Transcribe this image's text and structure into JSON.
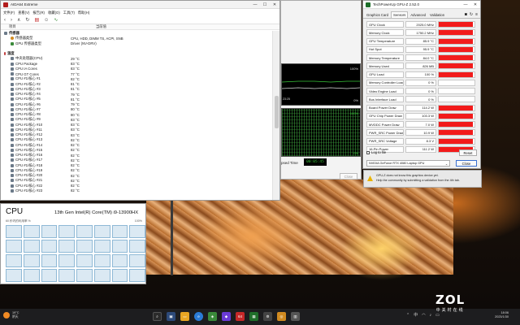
{
  "aida": {
    "title": "AIDA64 Extreme",
    "menu": [
      "文件(F)",
      "查看(V)",
      "报告(R)",
      "收藏(O)",
      "工具(T)",
      "帮助(H)"
    ],
    "col_item": "项目",
    "col_value": "当前值",
    "rows": [
      {
        "label": "传感器",
        "value": "",
        "type": "section",
        "icon": "chip"
      },
      {
        "label": "传感器类型",
        "value": "CPU, HDD, DIMM TS, ACPI, SNB",
        "type": "sub",
        "icon": "circle"
      },
      {
        "label": "GPU 传感器类型",
        "value": "Driver (NV-DRV)",
        "type": "sub",
        "icon": "gpu"
      },
      {
        "label": "",
        "value": "",
        "type": "blank",
        "icon": ""
      },
      {
        "label": "温度",
        "value": "",
        "type": "section",
        "icon": "therm"
      },
      {
        "label": "中央处理器(CPU)",
        "value": "29 °C",
        "type": "sub",
        "icon": "chip"
      },
      {
        "label": "CPU Package",
        "value": "83 °C",
        "type": "sub",
        "icon": "chip"
      },
      {
        "label": "CPU IA Cores",
        "value": "83 °C",
        "type": "sub",
        "icon": "chip"
      },
      {
        "label": "CPU GT Cores",
        "value": "77 °C",
        "type": "sub",
        "icon": "chip"
      },
      {
        "label": "CPU #1/核心 #1",
        "value": "82 °C",
        "type": "sub",
        "icon": "chip"
      },
      {
        "label": "CPU #1/核心 #2",
        "value": "81 °C",
        "type": "sub",
        "icon": "chip"
      },
      {
        "label": "CPU #1/核心 #3",
        "value": "81 °C",
        "type": "sub",
        "icon": "chip"
      },
      {
        "label": "CPU #1/核心 #4",
        "value": "79 °C",
        "type": "sub",
        "icon": "chip"
      },
      {
        "label": "CPU #1/核心 #5",
        "value": "81 °C",
        "type": "sub",
        "icon": "chip"
      },
      {
        "label": "CPU #1/核心 #6",
        "value": "79 °C",
        "type": "sub",
        "icon": "chip"
      },
      {
        "label": "CPU #1/核心 #7",
        "value": "80 °C",
        "type": "sub",
        "icon": "chip"
      },
      {
        "label": "CPU #1/核心 #8",
        "value": "80 °C",
        "type": "sub",
        "icon": "chip"
      },
      {
        "label": "CPU #1/核心 #9",
        "value": "83 °C",
        "type": "sub",
        "icon": "chip"
      },
      {
        "label": "CPU #1/核心 #10",
        "value": "83 °C",
        "type": "sub",
        "icon": "chip"
      },
      {
        "label": "CPU #1/核心 #11",
        "value": "83 °C",
        "type": "sub",
        "icon": "chip"
      },
      {
        "label": "CPU #1/核心 #12",
        "value": "83 °C",
        "type": "sub",
        "icon": "chip"
      },
      {
        "label": "CPU #1/核心 #13",
        "value": "82 °C",
        "type": "sub",
        "icon": "chip"
      },
      {
        "label": "CPU #1/核心 #14",
        "value": "82 °C",
        "type": "sub",
        "icon": "chip"
      },
      {
        "label": "CPU #1/核心 #15",
        "value": "82 °C",
        "type": "sub",
        "icon": "chip"
      },
      {
        "label": "CPU #1/核心 #16",
        "value": "82 °C",
        "type": "sub",
        "icon": "chip"
      },
      {
        "label": "CPU #1/核心 #17",
        "value": "82 °C",
        "type": "sub",
        "icon": "chip"
      },
      {
        "label": "CPU #1/核心 #18",
        "value": "82 °C",
        "type": "sub",
        "icon": "chip"
      },
      {
        "label": "CPU #1/核心 #19",
        "value": "82 °C",
        "type": "sub",
        "icon": "chip"
      },
      {
        "label": "CPU #1/核心 #20",
        "value": "82 °C",
        "type": "sub",
        "icon": "chip"
      },
      {
        "label": "CPU #1/核心 #21",
        "value": "82 °C",
        "type": "sub",
        "icon": "chip"
      },
      {
        "label": "CPU #1/核心 #22",
        "value": "82 °C",
        "type": "sub",
        "icon": "chip"
      },
      {
        "label": "CPU #1/核心 #23",
        "value": "82 °C",
        "type": "sub",
        "icon": "chip"
      }
    ]
  },
  "stability": {
    "graph_label_top": "23:25",
    "graph_pct_top": "100%",
    "graph_pct_top_low": "0%",
    "graph_pct_bottom": "100%",
    "graph_pct_bottom_low": "0%",
    "elapsed_label": "psed Time",
    "elapsed_value": "00:05:45",
    "close_label": "Close"
  },
  "gpuz": {
    "title": "TechPowerUp GPU-Z 2.52.0",
    "tabs": [
      "Graphics Card",
      "Sensors",
      "Advanced",
      "Validation"
    ],
    "active_tab": 1,
    "bar_color": "#f21b1b",
    "rows": [
      {
        "label": "GPU Clock",
        "value": "2025.0 MHz",
        "fill": 0.95
      },
      {
        "label": "Memory Clock",
        "value": "1750.2 MHz",
        "fill": 0.95
      },
      {
        "label": "GPU Temperature",
        "value": "85.9 °C",
        "fill": 0.95
      },
      {
        "label": "Hot Spot",
        "value": "95.9 °C",
        "fill": 0.95
      },
      {
        "label": "Memory Temperature",
        "value": "84.0 °C",
        "fill": 0.95
      },
      {
        "label": "Memory Used",
        "value": "826 MB",
        "fill": 0.95
      },
      {
        "label": "GPU Load",
        "value": "100 %",
        "fill": 0.95
      },
      {
        "label": "Memory Controller Load",
        "value": "0 %",
        "fill": 0
      },
      {
        "label": "Video Engine Load",
        "value": "0 %",
        "fill": 0
      },
      {
        "label": "Bus Interface Load",
        "value": "0 %",
        "fill": 0
      },
      {
        "label": "Board Power Draw",
        "value": "114.2 W",
        "fill": 0.95
      },
      {
        "label": "GPU Chip Power Draw",
        "value": "103.3 W",
        "fill": 0.95
      },
      {
        "label": "MVDDC Power Draw",
        "value": "7.0 W",
        "fill": 0.95
      },
      {
        "label": "PWR_SRC Power Draw",
        "value": "10.9 W",
        "fill": 0.95
      },
      {
        "label": "PWR_SRC Voltage",
        "value": "8.3 V",
        "fill": 0.95
      },
      {
        "label": "16-Pin Power",
        "value": "111.2 W",
        "fill": 0.95
      }
    ],
    "log_label": "Log to file",
    "reset_label": "Reset",
    "gpu_name": "NVIDIA GeForce RTX 4080 Laptop GPU",
    "close_label": "Close",
    "notice_line1": "GPU-Z does not know this graphics device yet.",
    "notice_line2": "Help the community by submitting a validation from the 4th tab."
  },
  "cpu": {
    "title": "CPU",
    "model": "13th Gen Intel(R) Core(TM) i9-13900HX",
    "subtitle": "60 秒内的利用率 %",
    "pct": "100%",
    "core_count": 32
  },
  "taskbar": {
    "temp": "19°C",
    "weather": "阴天",
    "time": "18:06",
    "date": "2023/1/30",
    "lang": "中"
  },
  "watermark": {
    "brand": "ZOL",
    "sub": "中关村在线"
  }
}
